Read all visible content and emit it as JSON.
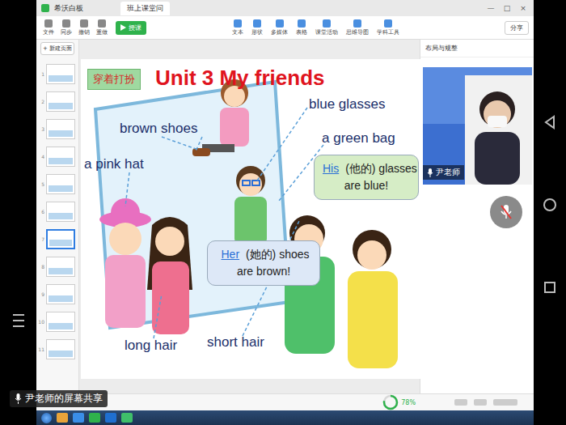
{
  "app": {
    "title": "希沃白板",
    "doc_tab": "班上课堂问",
    "window_controls": [
      "—",
      "□",
      "×"
    ]
  },
  "toolbar": {
    "left": [
      "文件",
      "同步",
      "撤销",
      "重做"
    ],
    "start": "授课",
    "tools": [
      "文本",
      "形状",
      "多媒体",
      "表格",
      "课堂活动",
      "思维导图",
      "学科工具"
    ],
    "share": "分享"
  },
  "pages": {
    "new_page": "+ 新建页面",
    "items": [
      {
        "number": "1",
        "selected": false
      },
      {
        "number": "2",
        "selected": false
      },
      {
        "number": "3",
        "selected": false
      },
      {
        "number": "4",
        "selected": false
      },
      {
        "number": "5",
        "selected": false
      },
      {
        "number": "6",
        "selected": false
      },
      {
        "number": "7",
        "selected": true
      },
      {
        "number": "8",
        "selected": false
      },
      {
        "number": "9",
        "selected": false
      },
      {
        "number": "10",
        "selected": false
      },
      {
        "number": "11",
        "selected": false
      }
    ]
  },
  "panel": {
    "title": "布局与规整",
    "speaker": "尹老师",
    "mic_muted": true
  },
  "slide": {
    "tag": "穿着打扮",
    "title": "Unit 3 My friends",
    "labels": [
      "brown shoes",
      "blue glasses",
      "a green bag",
      "a pink hat",
      "long hair",
      "short hair"
    ],
    "bubbles": [
      {
        "answer": "His",
        "hint": "(他的) glasses",
        "rest": "are blue!",
        "color": "#d6edc6"
      },
      {
        "answer": "Her",
        "hint": "(她的) shoes",
        "rest": "are brown!",
        "color": "#dde8f7"
      }
    ]
  },
  "status": {
    "zoom": "78%",
    "zoom_level": 0.78
  },
  "share_label": "尹老师的屏幕共享"
}
